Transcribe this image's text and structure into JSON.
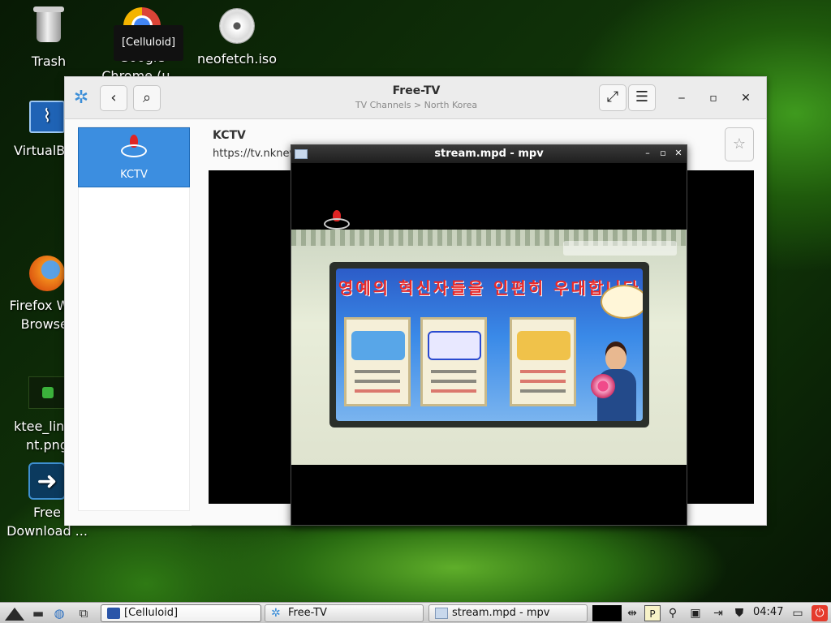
{
  "desktop": {
    "icons": [
      {
        "name": "trash",
        "label": "Trash"
      },
      {
        "name": "chrome",
        "label": "Google Chrome (u..."
      },
      {
        "name": "neofetch",
        "label": "neofetch.iso"
      },
      {
        "name": "virtualbox",
        "label": "VirtualBox"
      },
      {
        "name": "firefox",
        "label": "Firefox Web Browser"
      },
      {
        "name": "ktee",
        "label": "ktee_linux nt.png"
      },
      {
        "name": "fdm",
        "label": "Free Download ..."
      }
    ],
    "tooltip": "[Celluloid]"
  },
  "freetv": {
    "title": "Free-TV",
    "subtitle": "TV Channels > North Korea",
    "back_icon": "chevron-left-icon",
    "search_icon": "search-icon",
    "fullscreen_icon": "expand-icon",
    "menu_icon": "hamburger-icon",
    "sidebar": {
      "items": [
        {
          "label": "KCTV",
          "selected": true
        }
      ]
    },
    "channel": {
      "name": "KCTV",
      "url": "https://tv.nknew",
      "favorite_icon": "star-icon"
    }
  },
  "mpv": {
    "title": "stream.mpd - mpv",
    "video_text": "영예의 혁신자들을 인편히 우대합니다"
  },
  "taskbar": {
    "tasks": [
      {
        "label": "[Celluloid]",
        "active": true
      },
      {
        "label": "Free-TV",
        "active": false
      },
      {
        "label": "stream.mpd - mpv",
        "active": false
      }
    ],
    "clock": "04:47"
  },
  "colors": {
    "accent": "#3c8ee0",
    "desktop_green": "#2a6d12"
  }
}
